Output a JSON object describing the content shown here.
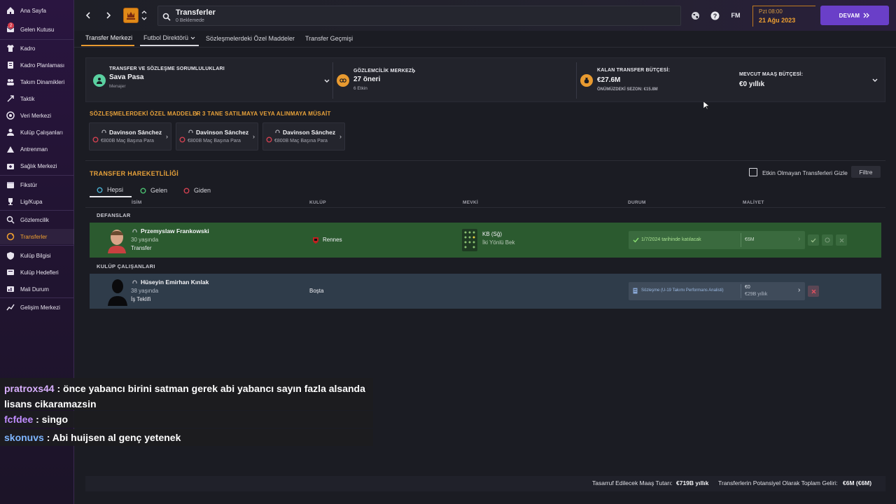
{
  "sidebar": {
    "items": [
      {
        "label": "Ana Sayfa",
        "icon": "home-icon"
      },
      {
        "label": "Gelen Kutusu",
        "icon": "inbox-icon",
        "badge": "2"
      },
      {
        "label": "Kadro",
        "icon": "shirt-icon"
      },
      {
        "label": "Kadro Planlaması",
        "icon": "clipboard-icon"
      },
      {
        "label": "Takım Dinamikleri",
        "icon": "team-icon"
      },
      {
        "label": "Taktik",
        "icon": "tactics-icon"
      },
      {
        "label": "Veri Merkezi",
        "icon": "data-icon"
      },
      {
        "label": "Kulüp Çalışanları",
        "icon": "staff-icon"
      },
      {
        "label": "Antrenman",
        "icon": "training-icon"
      },
      {
        "label": "Sağlık Merkezi",
        "icon": "medical-icon"
      },
      {
        "label": "Fikstür",
        "icon": "calendar-icon"
      },
      {
        "label": "Lig/Kupa",
        "icon": "trophy-icon"
      },
      {
        "label": "Gözlemcilik",
        "icon": "scouting-icon"
      },
      {
        "label": "Transferler",
        "icon": "transfer-icon",
        "active": true
      },
      {
        "label": "Kulüp Bilgisi",
        "icon": "shield-icon"
      },
      {
        "label": "Kulüp Hedefleri",
        "icon": "target-icon"
      },
      {
        "label": "Mali Durum",
        "icon": "finance-icon"
      },
      {
        "label": "Gelişim Merkezi",
        "icon": "development-icon"
      }
    ]
  },
  "topbar": {
    "title": "Transferler",
    "subtitle": "0 Beklemede",
    "fm_label": "FM",
    "date_time": "Pzt 08:00",
    "date_day": "21 Ağu 2023",
    "continue_label": "DEVAM"
  },
  "tabs": [
    {
      "label": "Transfer Merkezi",
      "active": true
    },
    {
      "label": "Futbol Direktörü"
    },
    {
      "label": "Sözleşmelerdeki Özel Maddeler"
    },
    {
      "label": "Transfer Geçmişi"
    }
  ],
  "summary": {
    "responsibility_caption": "TRANSFER VE SÖZLEŞME SORUMLULUKLARI",
    "responsibility_name": "Sava Pasa",
    "responsibility_role": "Menajer",
    "scouting_caption": "GÖZLEMCİLİK MERKEZİ",
    "scouting_value": "27 öneri",
    "scouting_sub": "6 Etkin",
    "budget_caption": "KALAN TRANSFER BÜTÇESİ:",
    "budget_value": "€27.6M",
    "budget_sub": "ÖNÜMÜZDEKİ SEZON: €15.8M",
    "wage_caption": "MEVCUT MAAŞ BÜTÇESİ:",
    "wage_value": "€0 yıllık"
  },
  "clauses": {
    "title": "SÖZLEŞMELERDEKİ ÖZEL MADDELER",
    "subtitle": "3 TANE SATILMAYA VEYA ALINMAYA MÜSAİT",
    "cards": [
      {
        "name": "Davinson Sánchez",
        "detail": "€800B Maç Başına Para"
      },
      {
        "name": "Davinson Sánchez",
        "detail": "€800B Maç Başına Para"
      },
      {
        "name": "Davinson Sánchez",
        "detail": "€800B Maç Başına Para"
      }
    ]
  },
  "activity": {
    "title": "TRANSFER HAREKETLİLİĞİ",
    "hide_inactive_label": "Etkin Olmayan Transferleri Gizle",
    "filter_label": "Filtre",
    "subtabs": [
      "Hepsi",
      "Gelen",
      "Giden"
    ],
    "columns": [
      "İSİM",
      "KULÜP",
      "MEVKİ",
      "DURUM",
      "MALİYET"
    ],
    "groups": [
      {
        "name": "DEFANSLAR",
        "player": "Przemyslaw Frankowski",
        "age": "30 yaşında",
        "type": "Transfer",
        "club": "Rennes",
        "position": "KB (Sğ)",
        "role": "İki Yönlü Bek",
        "status": "1/7/2024 tarihinde katılacak",
        "cost": "€6M"
      },
      {
        "name": "KULÜP ÇALIŞANLARI",
        "player": "Hüseyin Emirhan Kınlak",
        "age": "38 yaşında",
        "type": "İş Teklifi",
        "club": "Boşta",
        "status": "Sözleşme (U-19 Takımı Performans Analisti)",
        "cost": "€0",
        "cost_sub": "€29B yıllık"
      }
    ]
  },
  "footer": {
    "wage_savings_label": "Tasarruf Edilecek Maaş Tutarı:",
    "wage_savings_value": "€719B yıllık",
    "income_label": "Transferlerin Potansiyel Olarak Toplam Geliri:",
    "income_value": "€6M (€6M)"
  },
  "chat": [
    {
      "user": "pratroxs44",
      "text": ": önce yabancı birini satman gerek abi yabancı sayın fazla alsanda"
    },
    {
      "user": "",
      "text": "lisans cikaramazsin"
    },
    {
      "user": "fcfdee",
      "text": ": singo"
    },
    {
      "user": "skonuvs",
      "text": ": Abi huijsen al genç yetenek"
    }
  ],
  "colors": {
    "accent": "#e89a30",
    "continue": "#6a3fc8",
    "green_row": "#2b5a2f",
    "blue_row": "#2f3c4a"
  }
}
